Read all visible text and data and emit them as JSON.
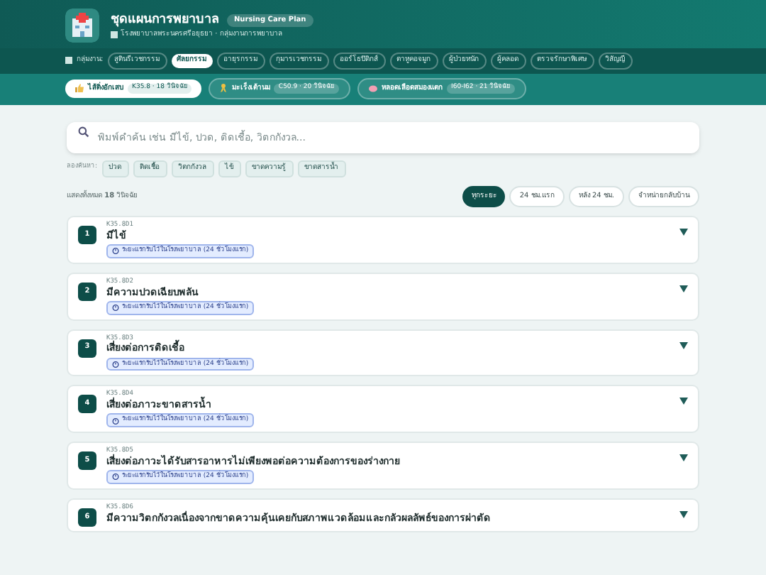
{
  "header": {
    "title": "ชุดแผนการพยาบาล",
    "badge": "Nursing Care Plan",
    "subtitle": "โรงพยาบาลพระนครศรีอยุธยา · กลุ่มงานการพยาบาล"
  },
  "departments": {
    "label": "กลุ่มงาน:",
    "items": [
      {
        "label": "สูตินรีเวชกรรม",
        "selected": false
      },
      {
        "label": "ศัลยกรรม",
        "selected": true
      },
      {
        "label": "อายุรกรรม",
        "selected": false
      },
      {
        "label": "กุมารเวชกรรม",
        "selected": false
      },
      {
        "label": "ออร์โธปิดิกส์",
        "selected": false
      },
      {
        "label": "ตาหูคอจมูก",
        "selected": false
      },
      {
        "label": "ผู้ป่วยหนัก",
        "selected": false
      },
      {
        "label": "ผู้คลอด",
        "selected": false
      },
      {
        "label": "ตรวจรักษาพิเศษ",
        "selected": false
      },
      {
        "label": "วิสัญญี",
        "selected": false
      }
    ]
  },
  "plans": [
    {
      "label": "ไส้ติ่งอักเสบ",
      "meta": "K35.8 · 18 วินิจฉัย",
      "selected": true
    },
    {
      "label": "มะเร็งเต้านม",
      "meta": "C50.9 · 20 วินิจฉัย",
      "selected": false
    },
    {
      "label": "หลอดเลือดสมองแตก",
      "meta": "I60-I62 · 21 วินิจฉัย",
      "selected": false
    }
  ],
  "search": {
    "placeholder": "พิมพ์คำค้น เช่น มีไข้, ปวด, ติดเชื้อ, วิตกกังวล..."
  },
  "suggestions": {
    "label": "ลองค้นหา:",
    "items": [
      "ปวด",
      "ติดเชื้อ",
      "วิตกกังวล",
      "ไข้",
      "ขาดความรู้",
      "ขาดสารน้ำ"
    ]
  },
  "summary": "แสดงทั้งหมด **18** วินิจฉัย",
  "phase_filters": [
    {
      "label": "ทุกระยะ",
      "selected": true
    },
    {
      "label": "24 ชม.แรก",
      "selected": false
    },
    {
      "label": "หลัง 24 ชม.",
      "selected": false
    },
    {
      "label": "จำหน่ายกลับบ้าน",
      "selected": false
    }
  ],
  "diagnoses": [
    {
      "number": "1",
      "code": "K35.8D1",
      "title": "มีไข้",
      "phase": "ระยะแรกรับไว้ในโรงพยาบาล (24 ชั่วโมงแรก)",
      "expanded": false
    },
    {
      "number": "2",
      "code": "K35.8D2",
      "title": "มีความปวดเฉียบพลัน",
      "phase": "ระยะแรกรับไว้ในโรงพยาบาล (24 ชั่วโมงแรก)",
      "expanded": false
    },
    {
      "number": "3",
      "code": "K35.8D3",
      "title": "เสี่ยงต่อการติดเชื้อ",
      "phase": "ระยะแรกรับไว้ในโรงพยาบาล (24 ชั่วโมงแรก)",
      "expanded": false
    },
    {
      "number": "4",
      "code": "K35.8D4",
      "title": "เสี่ยงต่อภาวะขาดสารน้ำ",
      "phase": "ระยะแรกรับไว้ในโรงพยาบาล (24 ชั่วโมงแรก)",
      "expanded": false
    },
    {
      "number": "5",
      "code": "K35.8D5",
      "title": "เสี่ยงต่อภาวะได้รับสารอาหารไม่เพียงพอต่อความต้องการของร่างกาย",
      "phase": "ระยะแรกรับไว้ในโรงพยาบาล (24 ชั่วโมงแรก)",
      "expanded": false
    },
    {
      "number": "6",
      "code": "K35.8D6",
      "title": "มีความวิตกกังวลเนื่องจากขาดความคุ้นเคยกับสภาพแวดล้อมและกลัวผลลัพธ์ของการผ่าตัด",
      "expanded": false
    }
  ]
}
